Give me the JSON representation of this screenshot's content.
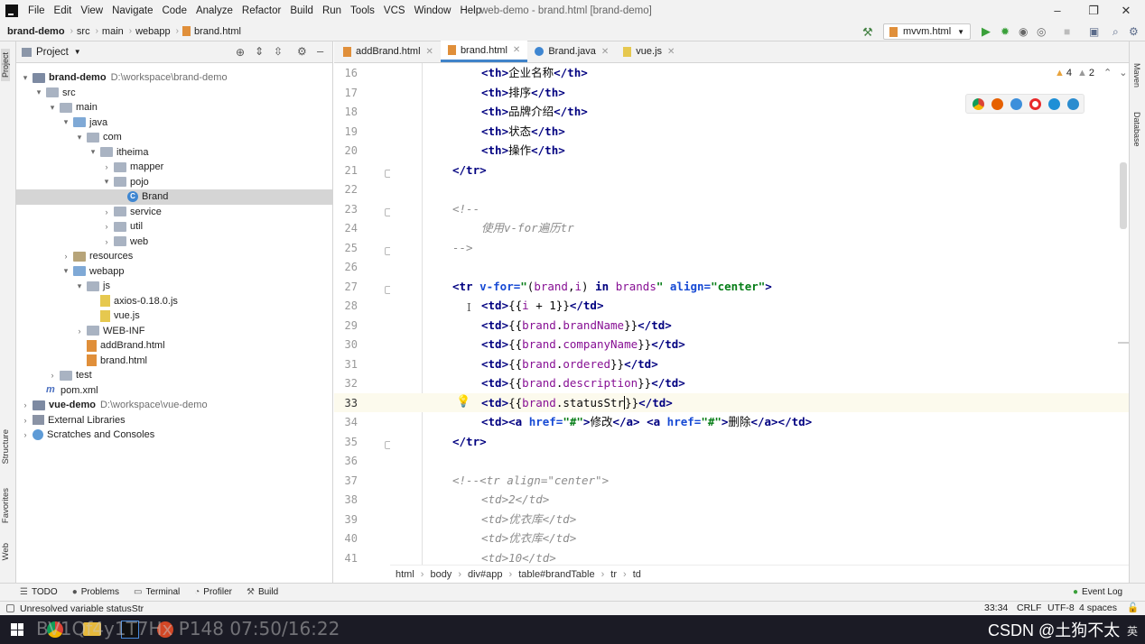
{
  "app": {
    "menu": [
      "File",
      "Edit",
      "View",
      "Navigate",
      "Code",
      "Analyze",
      "Refactor",
      "Build",
      "Run",
      "Tools",
      "VCS",
      "Window",
      "Help"
    ],
    "window_title": "web-demo - brand.html [brand-demo]"
  },
  "navbar": {
    "breadcrumb": [
      "brand-demo",
      "src",
      "main",
      "webapp",
      "brand.html"
    ],
    "run_config": "mvvm.html"
  },
  "project_panel": {
    "title": "Project",
    "tree": [
      {
        "label": "brand-demo",
        "path": "D:\\workspace\\brand-demo",
        "icon": "module-icon",
        "depth": 0,
        "arrow": "▾"
      },
      {
        "label": "src",
        "depth": 1,
        "arrow": "▾",
        "icon": "folder-icon"
      },
      {
        "label": "main",
        "depth": 2,
        "arrow": "▾",
        "icon": "folder-icon"
      },
      {
        "label": "java",
        "depth": 3,
        "arrow": "▾",
        "icon": "source-folder-icon"
      },
      {
        "label": "com",
        "depth": 4,
        "arrow": "▾",
        "icon": "package-icon"
      },
      {
        "label": "itheima",
        "depth": 5,
        "arrow": "▾",
        "icon": "package-icon"
      },
      {
        "label": "mapper",
        "depth": 6,
        "arrow": "›",
        "icon": "package-icon"
      },
      {
        "label": "pojo",
        "depth": 6,
        "arrow": "▾",
        "icon": "package-icon"
      },
      {
        "label": "Brand",
        "depth": 7,
        "arrow": "",
        "icon": "class-icon",
        "selected": true
      },
      {
        "label": "service",
        "depth": 6,
        "arrow": "›",
        "icon": "package-icon"
      },
      {
        "label": "util",
        "depth": 6,
        "arrow": "›",
        "icon": "package-icon"
      },
      {
        "label": "web",
        "depth": 6,
        "arrow": "›",
        "icon": "package-icon"
      },
      {
        "label": "resources",
        "depth": 3,
        "arrow": "›",
        "icon": "resources-folder-icon"
      },
      {
        "label": "webapp",
        "depth": 3,
        "arrow": "▾",
        "icon": "web-folder-icon"
      },
      {
        "label": "js",
        "depth": 4,
        "arrow": "▾",
        "icon": "folder-icon"
      },
      {
        "label": "axios-0.18.0.js",
        "depth": 5,
        "arrow": "",
        "icon": "js-file-icon"
      },
      {
        "label": "vue.js",
        "depth": 5,
        "arrow": "",
        "icon": "js-file-icon"
      },
      {
        "label": "WEB-INF",
        "depth": 4,
        "arrow": "›",
        "icon": "folder-icon"
      },
      {
        "label": "addBrand.html",
        "depth": 4,
        "arrow": "",
        "icon": "html-file-icon"
      },
      {
        "label": "brand.html",
        "depth": 4,
        "arrow": "",
        "icon": "html-file-icon"
      },
      {
        "label": "test",
        "depth": 2,
        "arrow": "›",
        "icon": "folder-icon"
      },
      {
        "label": "pom.xml",
        "depth": 1,
        "arrow": "",
        "icon": "maven-icon"
      },
      {
        "label": "vue-demo",
        "path": "D:\\workspace\\vue-demo",
        "depth": 0,
        "arrow": "›",
        "icon": "module-icon"
      },
      {
        "label": "External Libraries",
        "depth": 0,
        "arrow": "›",
        "icon": "library-icon"
      },
      {
        "label": "Scratches and Consoles",
        "depth": 0,
        "arrow": "›",
        "icon": "scratch-icon"
      }
    ]
  },
  "editor": {
    "tabs": [
      {
        "label": "addBrand.html",
        "active": false
      },
      {
        "label": "brand.html",
        "active": true
      },
      {
        "label": "Brand.java",
        "active": false
      },
      {
        "label": "vue.js",
        "active": false
      }
    ],
    "inspections": {
      "warnings": "4",
      "weak_warnings": "2"
    },
    "line_numbers": [
      "16",
      "17",
      "18",
      "19",
      "20",
      "21",
      "22",
      "23",
      "24",
      "25",
      "26",
      "27",
      "28",
      "29",
      "30",
      "31",
      "32",
      "33",
      "34",
      "35",
      "36",
      "37",
      "38",
      "39",
      "40",
      "41"
    ],
    "current_line": "33",
    "breadcrumb": [
      "html",
      "body",
      "div#app",
      "table#brandTable",
      "tr",
      "td"
    ]
  },
  "bottom_tools": [
    "TODO",
    "Problems",
    "Terminal",
    "Profiler",
    "Build"
  ],
  "event_log": "Event Log",
  "status": {
    "message": "Unresolved variable statusStr",
    "position": "33:34",
    "line_sep": "CRLF",
    "encoding": "UTF-8",
    "indent": "4 spaces"
  },
  "overlay": {
    "video_text": "BV1Qf4y1T7Hx P148 07:50/16:22",
    "watermark": "CSDN @土狗不太",
    "ime": "英"
  },
  "side_tabs": {
    "left": [
      "Project",
      "Structure",
      "Favorites",
      "Web"
    ],
    "right": [
      "Maven",
      "Database"
    ]
  }
}
